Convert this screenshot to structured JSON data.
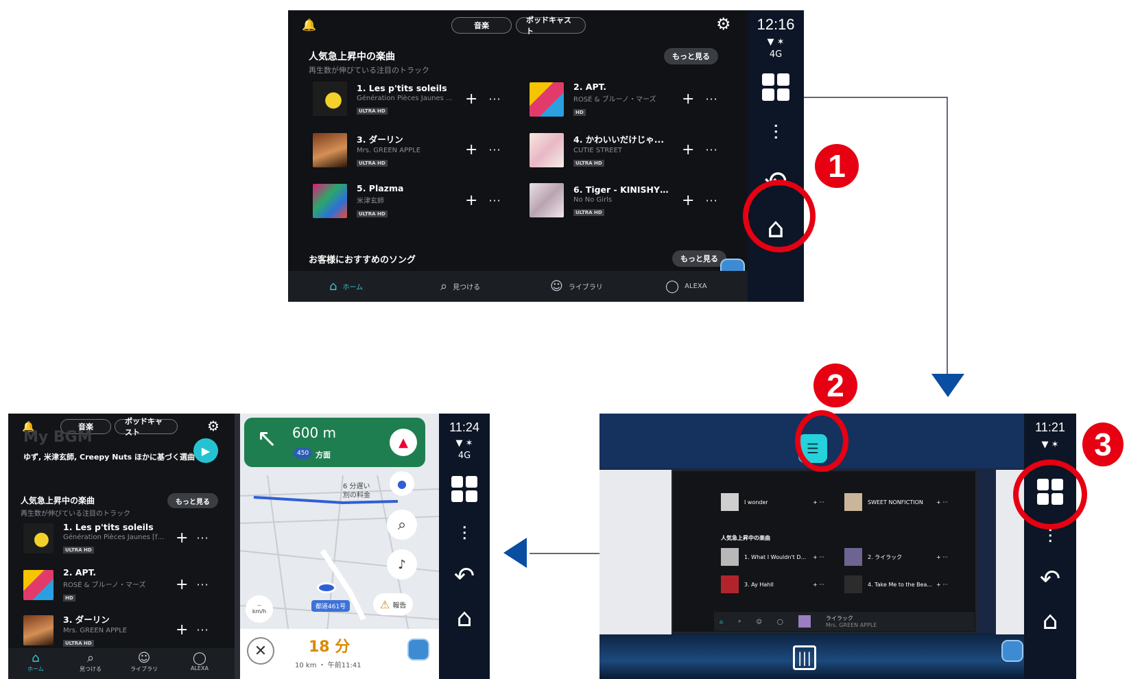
{
  "top": {
    "tabs": [
      "音楽",
      "ポッドキャスト"
    ],
    "clock": "12:16",
    "network": "4G",
    "section1_title": "人気急上昇中の楽曲",
    "section1_sub": "再生数が伸びている注目のトラック",
    "more": "もっと見る",
    "section2_title": "お客様におすすめのソング",
    "tracks": [
      {
        "title": "1. Les p'tits soleils",
        "artist": "Génération Pièces Jaunes ...",
        "badge": "ULTRA HD"
      },
      {
        "title": "2. APT.",
        "artist": "ROSÉ & ブルーノ・マーズ",
        "badge": "HD"
      },
      {
        "title": "3. ダーリン",
        "artist": "Mrs. GREEN APPLE",
        "badge": "ULTRA HD"
      },
      {
        "title": "4. かわいいだけじゃ...",
        "artist": "CUTIE STREET",
        "badge": "ULTRA HD"
      },
      {
        "title": "5. Plazma",
        "artist": "米津玄師",
        "badge": "ULTRA HD"
      },
      {
        "title": "6. Tiger - KINISHY ver...",
        "artist": "No No Girls",
        "badge": "ULTRA HD"
      }
    ],
    "bottom_tabs": [
      "ホーム",
      "見つける",
      "ライブラリ",
      "ALEXA"
    ]
  },
  "mid": {
    "clock": "11:21",
    "thumb_tracks": [
      {
        "title": "I wonder",
        "artist": ""
      },
      {
        "title": "SWEET NONFICTION",
        "artist": ""
      },
      {
        "title": "1. What I Wouldn't D...",
        "artist": ""
      },
      {
        "title": "2. ライラック",
        "artist": ""
      },
      {
        "title": "3. Ay Hahll",
        "artist": ""
      },
      {
        "title": "4. Take Me to the Bea...",
        "artist": ""
      }
    ],
    "thumb_section": "人気急上昇中の楽曲",
    "thumb_now": "ライラック",
    "thumb_now_artist": "Mrs. GREEN APPLE"
  },
  "bottom": {
    "clock": "11:24",
    "network": "4G",
    "tabs": [
      "音楽",
      "ポッドキャスト"
    ],
    "banner_title": "My BGM",
    "banner_sub": "ゆず, 米津玄師, Creepy Nuts ほかに基づく選曲",
    "section_title": "人気急上昇中の楽曲",
    "section_sub": "再生数が伸びている注目のトラック",
    "more": "もっと見る",
    "tracks": [
      {
        "title": "1. Les p'tits soleils",
        "artist": "Génération Pièces Jaunes [fea...",
        "badge": "ULTRA HD"
      },
      {
        "title": "2. APT.",
        "artist": "ROSÉ & ブルーノ・マーズ",
        "badge": "HD"
      },
      {
        "title": "3. ダーリン",
        "artist": "Mrs. GREEN APPLE",
        "badge": "ULTRA HD"
      }
    ],
    "bottom_tabs": [
      "ホーム",
      "見つける",
      "ライブラリ",
      "ALEXA"
    ],
    "nav": {
      "distance": "600 m",
      "route_num": "450",
      "direction": "方面",
      "delay": "6 分遅い",
      "delay_sub": "別の料金",
      "road": "都道461号",
      "report": "報告",
      "speed_unit": "km/h",
      "eta_min": "18 分",
      "eta_sub": "10 km ・ 午前11:41"
    }
  },
  "callouts": [
    "1",
    "2",
    "3"
  ]
}
